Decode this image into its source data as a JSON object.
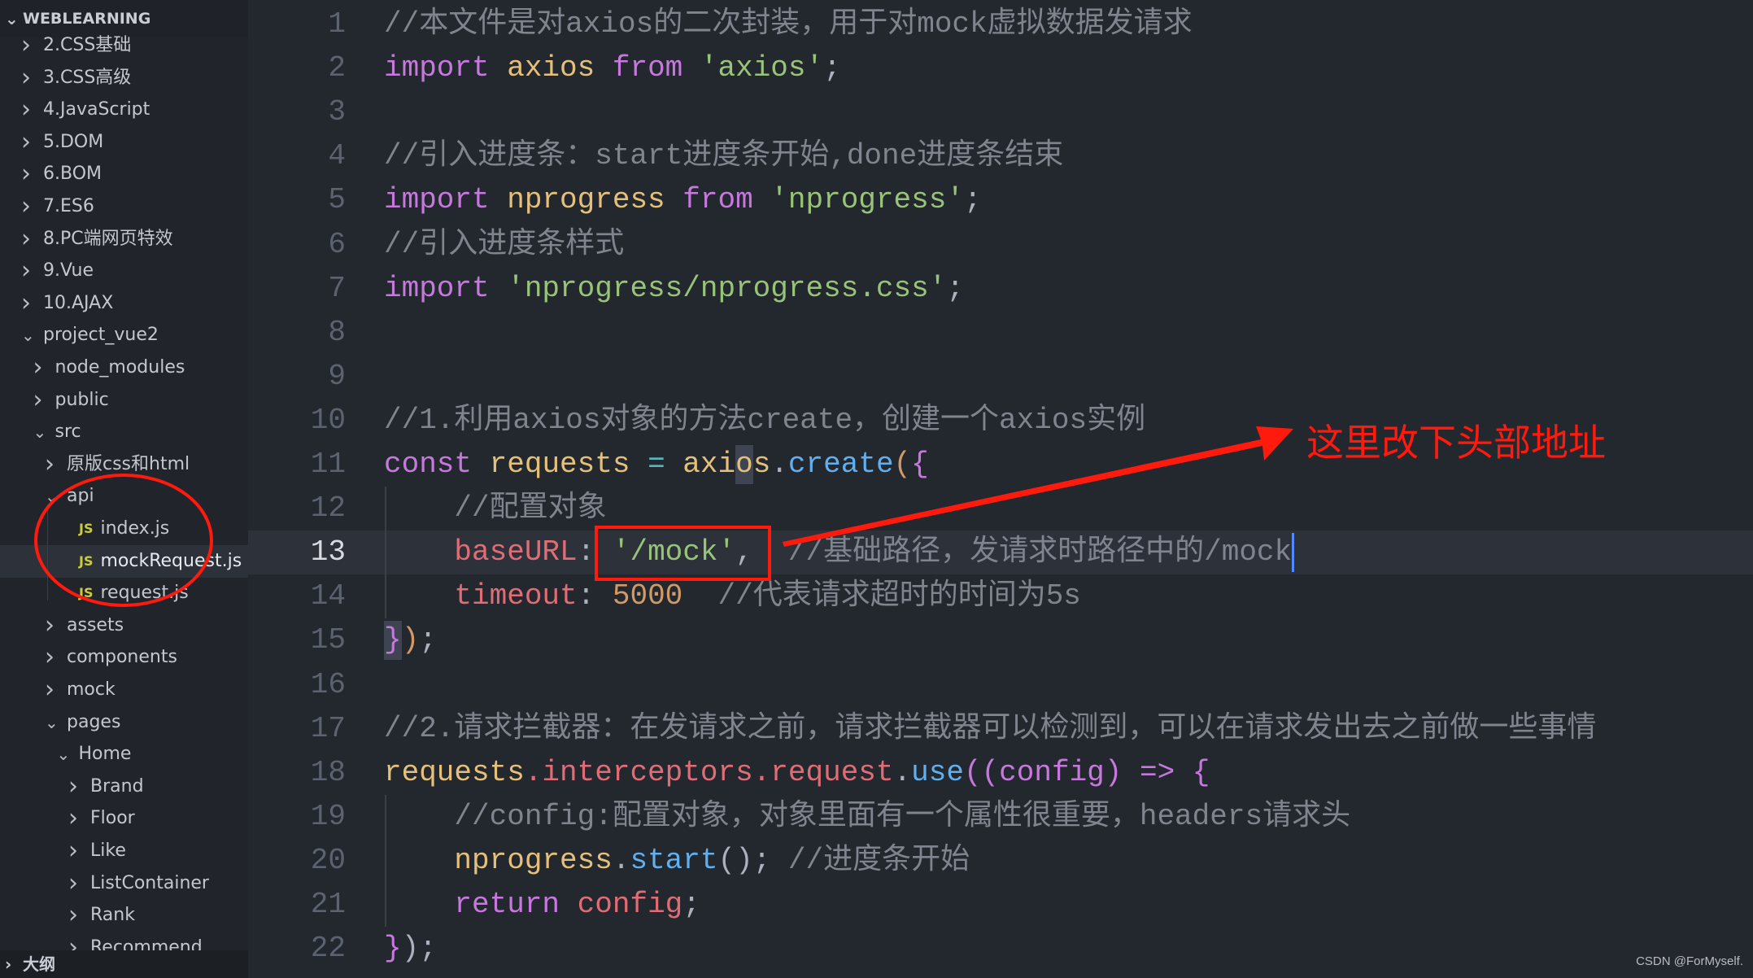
{
  "sidebar": {
    "root_label": "WEBLEARNING",
    "items": [
      {
        "label": "2.CSS基础",
        "level": 0,
        "type": "folder",
        "expanded": false
      },
      {
        "label": "3.CSS高级",
        "level": 0,
        "type": "folder",
        "expanded": false
      },
      {
        "label": "4.JavaScript",
        "level": 0,
        "type": "folder",
        "expanded": false
      },
      {
        "label": "5.DOM",
        "level": 0,
        "type": "folder",
        "expanded": false
      },
      {
        "label": "6.BOM",
        "level": 0,
        "type": "folder",
        "expanded": false
      },
      {
        "label": "7.ES6",
        "level": 0,
        "type": "folder",
        "expanded": false
      },
      {
        "label": "8.PC端网页特效",
        "level": 0,
        "type": "folder",
        "expanded": false
      },
      {
        "label": "9.Vue",
        "level": 0,
        "type": "folder",
        "expanded": false
      },
      {
        "label": "10.AJAX",
        "level": 0,
        "type": "folder",
        "expanded": false
      },
      {
        "label": "project_vue2",
        "level": 0,
        "type": "folder",
        "expanded": true
      },
      {
        "label": "node_modules",
        "level": 1,
        "type": "folder",
        "expanded": false
      },
      {
        "label": "public",
        "level": 1,
        "type": "folder",
        "expanded": false
      },
      {
        "label": "src",
        "level": 1,
        "type": "folder",
        "expanded": true
      },
      {
        "label": "原版css和html",
        "level": 2,
        "type": "folder",
        "expanded": false
      },
      {
        "label": "api",
        "level": 2,
        "type": "folder",
        "expanded": true
      },
      {
        "label": "index.js",
        "level": 3,
        "type": "js",
        "icon": "JS"
      },
      {
        "label": "mockRequest.js",
        "level": 3,
        "type": "js",
        "icon": "JS",
        "selected": true
      },
      {
        "label": "request.js",
        "level": 3,
        "type": "js",
        "icon": "JS"
      },
      {
        "label": "assets",
        "level": 2,
        "type": "folder",
        "expanded": false
      },
      {
        "label": "components",
        "level": 2,
        "type": "folder",
        "expanded": false
      },
      {
        "label": "mock",
        "level": 2,
        "type": "folder",
        "expanded": false
      },
      {
        "label": "pages",
        "level": 2,
        "type": "folder",
        "expanded": true
      },
      {
        "label": "Home",
        "level": 3,
        "type": "folder",
        "expanded": true
      },
      {
        "label": "Brand",
        "level": 4,
        "type": "folder",
        "expanded": false
      },
      {
        "label": "Floor",
        "level": 4,
        "type": "folder",
        "expanded": false
      },
      {
        "label": "Like",
        "level": 4,
        "type": "folder",
        "expanded": false
      },
      {
        "label": "ListContainer",
        "level": 4,
        "type": "folder",
        "expanded": false
      },
      {
        "label": "Rank",
        "level": 4,
        "type": "folder",
        "expanded": false
      },
      {
        "label": "Recommend",
        "level": 4,
        "type": "folder",
        "expanded": false
      }
    ],
    "outline_label": "大纲"
  },
  "colors": {
    "keyword": "#c678dd",
    "variable": "#e5c07b",
    "function": "#61afef",
    "string": "#98c379",
    "property": "#e06c75",
    "number": "#d19a66",
    "comment": "#7f848e",
    "punct": "#abb2bf",
    "operator": "#56b6c2",
    "param": "#c678dd",
    "annotation": "#ff1a0e",
    "js_icon": "#cbcb41"
  },
  "editor": {
    "active_line": 13,
    "lines": [
      [
        [
          "//本文件是对axios的二次封装，用于对mock虚拟数据发请求",
          "comment"
        ]
      ],
      [
        [
          "import",
          "keyword"
        ],
        [
          " axios ",
          "variable"
        ],
        [
          "from",
          "keyword"
        ],
        [
          " 'axios'",
          "string"
        ],
        [
          ";",
          "punct"
        ]
      ],
      [],
      [
        [
          "//引入进度条：start进度条开始,done进度条结束",
          "comment"
        ]
      ],
      [
        [
          "import",
          "keyword"
        ],
        [
          " nprogress ",
          "variable"
        ],
        [
          "from",
          "keyword"
        ],
        [
          " 'nprogress'",
          "string"
        ],
        [
          ";",
          "punct"
        ]
      ],
      [
        [
          "//引入进度条样式",
          "comment"
        ]
      ],
      [
        [
          "import",
          "keyword"
        ],
        [
          " 'nprogress/nprogress.css'",
          "string"
        ],
        [
          ";",
          "punct"
        ]
      ],
      [],
      [],
      [
        [
          "//1.利用axios对象的方法create，创建一个axios实例",
          "comment"
        ]
      ],
      [
        [
          "const",
          "keyword"
        ],
        [
          " requests ",
          "variable"
        ],
        [
          "=",
          "operator"
        ],
        [
          " axios",
          "variable"
        ],
        [
          ".",
          "punct"
        ],
        [
          "create",
          "function"
        ],
        [
          "(",
          "number"
        ],
        [
          "{",
          "keyword"
        ]
      ],
      [
        [
          "    //配置对象",
          "comment"
        ]
      ],
      [
        [
          "    baseURL",
          "property"
        ],
        [
          ": ",
          "punct"
        ],
        [
          "'/mock'",
          "string"
        ],
        [
          ",  ",
          "punct"
        ],
        [
          "//基础路径，发请求时路径中的/mock",
          "comment"
        ]
      ],
      [
        [
          "    timeout",
          "property"
        ],
        [
          ": ",
          "punct"
        ],
        [
          "5000",
          "number"
        ],
        [
          "  //代表请求超时的时间为5s",
          "comment"
        ]
      ],
      [
        [
          "}",
          "keyword"
        ],
        [
          ")",
          "number"
        ],
        [
          ";",
          "punct"
        ]
      ],
      [],
      [
        [
          "//2.请求拦截器：在发请求之前，请求拦截器可以检测到，可以在请求发出去之前做一些事情",
          "comment"
        ]
      ],
      [
        [
          "requests",
          "variable"
        ],
        [
          ".interceptors.request",
          "property"
        ],
        [
          ".",
          "punct"
        ],
        [
          "use",
          "function"
        ],
        [
          "(",
          "keyword"
        ],
        [
          "(config) => {",
          "param"
        ]
      ],
      [
        [
          "    //config:配置对象，对象里面有一个属性很重要，headers请求头",
          "comment"
        ]
      ],
      [
        [
          "    nprogress",
          "variable"
        ],
        [
          ".",
          "punct"
        ],
        [
          "start",
          "function"
        ],
        [
          "();",
          "punct"
        ],
        [
          " //进度条开始",
          "comment"
        ]
      ],
      [
        [
          "    return",
          "keyword"
        ],
        [
          " config",
          "property"
        ],
        [
          ";",
          "punct"
        ]
      ],
      [
        [
          "}",
          "keyword"
        ],
        [
          ");",
          "punct"
        ]
      ]
    ]
  },
  "annotation": {
    "text": "这里改下头部地址"
  },
  "watermark": "CSDN @ForMyself."
}
